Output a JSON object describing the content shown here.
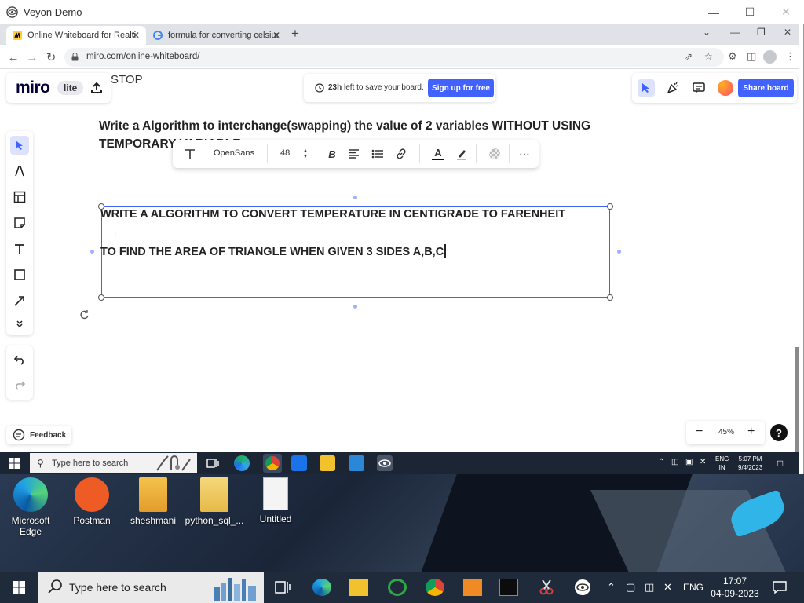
{
  "veyon": {
    "title": "Veyon Demo"
  },
  "chrome": {
    "tabs": [
      {
        "label": "Online Whiteboard for Realtime C"
      },
      {
        "label": "formula for converting celsius int"
      }
    ],
    "url": "miro.com/online-whiteboard/"
  },
  "miro": {
    "logo": "miro",
    "lite_badge": "lite",
    "partial_text": "STOP",
    "save_hours": "23h",
    "save_text": "left to save your board.",
    "signup_label": "Sign up for free",
    "share_board_label": "Share board",
    "heading_text": "Write a Algorithm to interchange(swapping) the value of 2 variables WITHOUT USING TEMPORARY VARIABLE",
    "format_bar": {
      "font": "OpenSans",
      "size": "48"
    },
    "selected_line1": "WRITE A ALGORITHM TO CONVERT TEMPERATURE IN CENTIGRADE TO FARENHEIT",
    "selected_line2": "TO FIND THE AREA OF TRIANGLE WHEN GIVEN 3 SIDES A,B,C",
    "feedback_label": "Feedback",
    "zoom": "45%",
    "help": "?"
  },
  "inner_taskbar": {
    "search_placeholder": "Type here to search",
    "lang1": "ENG",
    "lang2": "IN",
    "time": "5:07 PM",
    "date": "9/4/2023"
  },
  "desktop": {
    "icons": [
      {
        "label1": "Microsoft",
        "label2": "Edge"
      },
      {
        "label1": "Postman",
        "label2": ""
      },
      {
        "label1": "sheshmani",
        "label2": ""
      },
      {
        "label1": "python_sql_...",
        "label2": ""
      },
      {
        "label1": "Untitled",
        "label2": ""
      }
    ]
  },
  "taskbar": {
    "search_placeholder": "Type here to search",
    "lang": "ENG",
    "time": "17:07",
    "date": "04-09-2023"
  },
  "colors": {
    "miro_blue": "#4262ff",
    "selection": "#4262ff"
  }
}
